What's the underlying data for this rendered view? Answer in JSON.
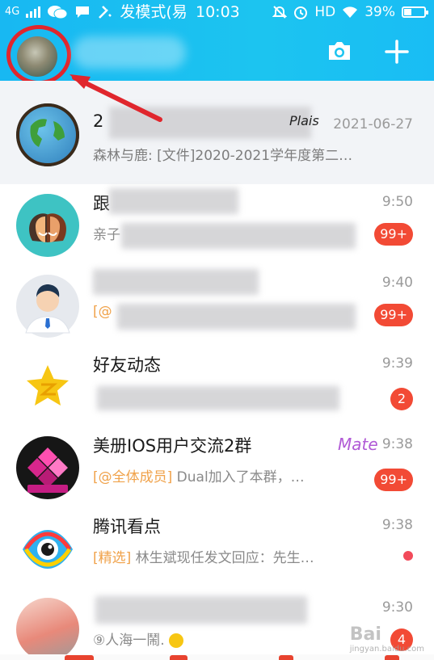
{
  "status_bar": {
    "network": "4G",
    "mode_text": "发模式(易",
    "time": "10:03",
    "hd": "HD",
    "battery_percent": "39%",
    "battery_level": 0.39
  },
  "header": {
    "camera_icon": "camera-icon",
    "add_icon": "plus-icon"
  },
  "conversations": [
    {
      "title": "2",
      "time": "2021-06-27",
      "sender": "森林与鹿:",
      "message": "[文件]2020-2021学年度第二…",
      "pinned": true,
      "avatar_color": "#2b8a3e"
    },
    {
      "title": "跟",
      "time": "9:50",
      "message": "亲子",
      "badge": "99+",
      "avatar_color": "#3ec3c3"
    },
    {
      "title": "",
      "time": "9:40",
      "tag": "[@",
      "message": "",
      "badge": "99+",
      "avatar_color": "#e4e8ee"
    },
    {
      "title": "好友动态",
      "time": "9:39",
      "message": "",
      "badge": "2",
      "avatar_color": "#ffffff"
    },
    {
      "title": "美册IOS用户交流2群",
      "time": "9:38",
      "tag": "[@全体成员]",
      "message": "Dual加入了本群，…",
      "badge": "99+",
      "decoration": "Mate",
      "avatar_color": "#1b1b1b"
    },
    {
      "title": "腾讯看点",
      "time": "9:38",
      "tag": "[精选]",
      "message": "林生斌现任发文回应：先生…",
      "dot": true,
      "avatar_color": "#ffffff"
    },
    {
      "title": "",
      "time": "9:30",
      "message": "⑨人海一鬧.",
      "badge": "4",
      "avatar_color": "#f3c1b5"
    }
  ],
  "watermark": {
    "brand": "Bai",
    "sub": "jingyan.baidu.com"
  },
  "colors": {
    "header": "#1cc4f0",
    "badge": "#f24a35",
    "tag": "#f0a24a",
    "highlight": "#e0262d"
  }
}
